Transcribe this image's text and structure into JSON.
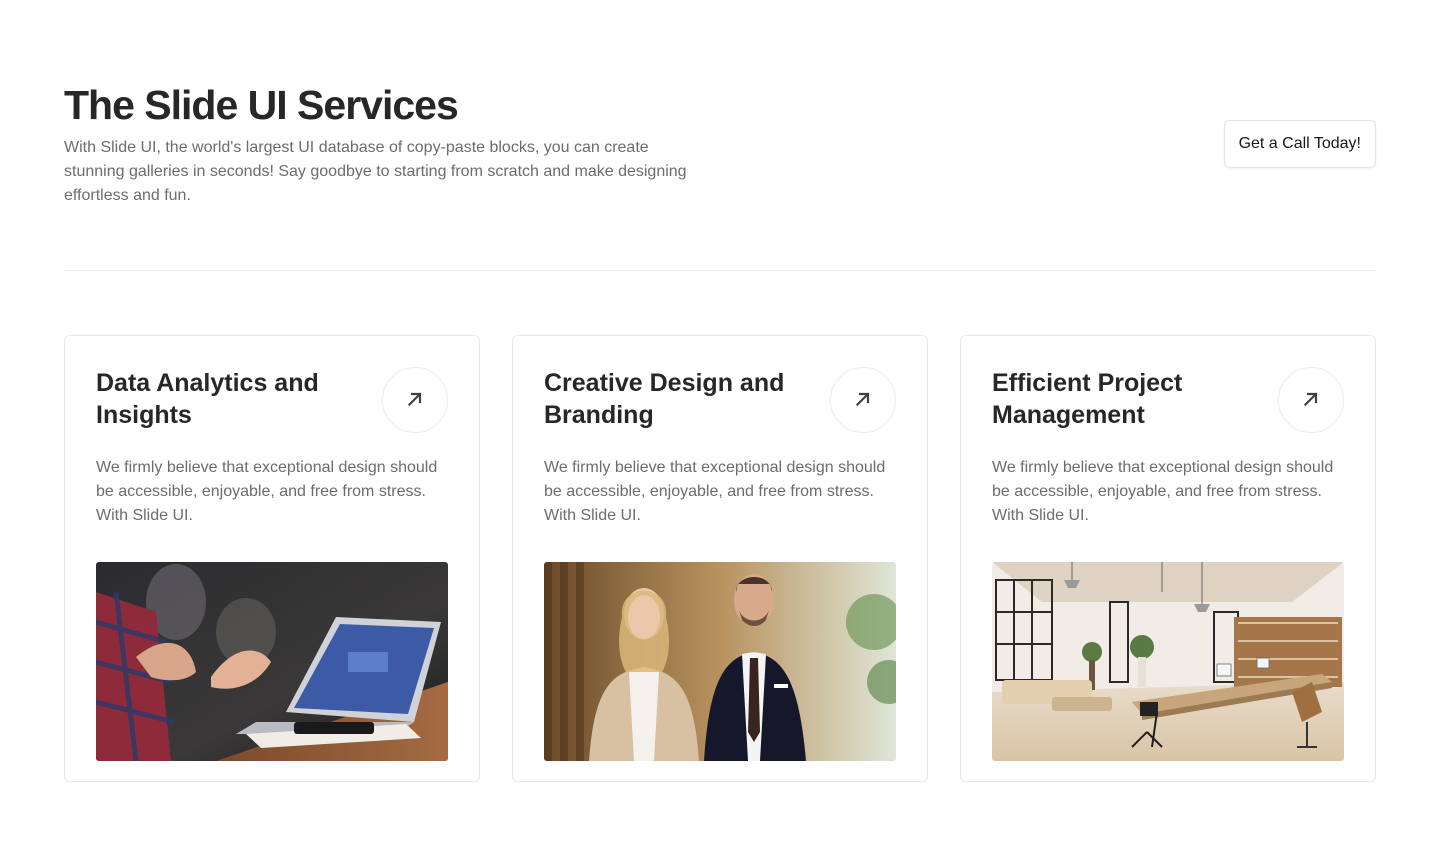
{
  "header": {
    "title": "The Slide UI Services",
    "subtitle": "With Slide UI, the world's largest UI database of copy-paste blocks, you can create stunning galleries in seconds! Say goodbye to starting from scratch and make designing effortless and fun.",
    "cta_label": "Get a Call Today!"
  },
  "cards": [
    {
      "title": "Data Analytics and Insights",
      "description": "We firmly believe that exceptional design should be accessible, enjoyable, and free from stress. With Slide UI.",
      "icon": "arrow-up-right-icon"
    },
    {
      "title": "Creative Design and Branding",
      "description": "We firmly believe that exceptional design should be accessible, enjoyable, and free from stress. With Slide UI.",
      "icon": "arrow-up-right-icon"
    },
    {
      "title": "Efficient Project Management",
      "description": "We firmly believe that exceptional design should be accessible, enjoyable, and free from stress. With Slide UI.",
      "icon": "arrow-up-right-icon"
    }
  ],
  "colors": {
    "text_primary": "#27272a",
    "text_muted": "#6b6b73",
    "border": "#e8e8eb"
  }
}
